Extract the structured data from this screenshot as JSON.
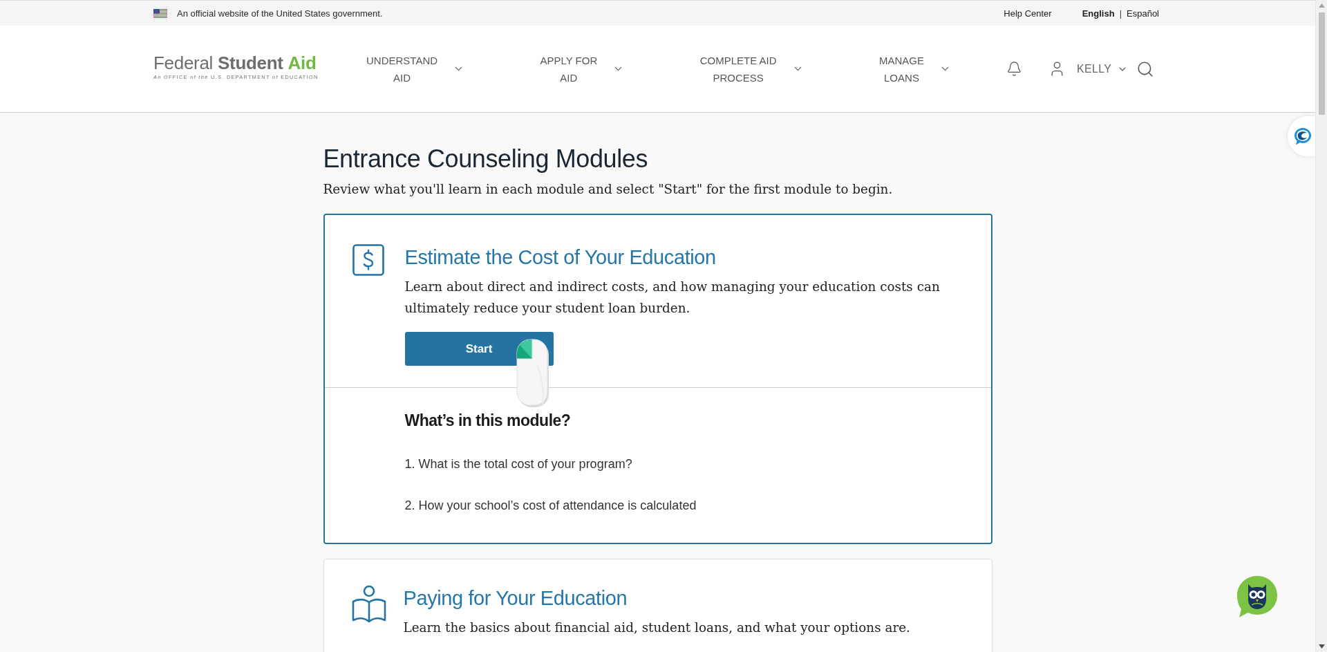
{
  "gov_banner": {
    "text": "An official website of the United States government.",
    "help_link": "Help Center",
    "languages": [
      {
        "label": "English",
        "selected": true
      },
      {
        "label": "Español",
        "selected": false
      }
    ],
    "language_separator": "|"
  },
  "header": {
    "logo": {
      "parts": [
        {
          "text": "Federal",
          "kind": "light"
        },
        {
          "text": "Student",
          "kind": "bold"
        },
        {
          "text": "Aid",
          "kind": "accent"
        }
      ],
      "tagline": "*An* OFFICE *of the* U.S. DEPARTMENT *of* EDUCATION"
    },
    "nav": [
      {
        "label": "UNDERSTAND AID"
      },
      {
        "label": "APPLY FOR AID"
      },
      {
        "label": "COMPLETE AID PROCESS"
      },
      {
        "label": "MANAGE LOANS"
      }
    ],
    "user": {
      "name": "KELLY"
    }
  },
  "page": {
    "title": "Entrance Counseling Modules",
    "intro": "Review what you'll learn in each module and select \"Start\" for the first module to begin."
  },
  "modules": [
    {
      "selected": true,
      "title": "Estimate the Cost of Your Education",
      "description": "Learn about direct and indirect costs, and how managing your education costs can ultimately reduce your student loan burden.",
      "button": "Start",
      "contents_heading": "What’s in this module?",
      "topics": [
        "1. What is the total cost of your program?",
        "2. How your school’s cost of attendance is calculated"
      ]
    },
    {
      "selected": false,
      "title": "Paying for Your Education",
      "description": "Learn the basics about financial aid, student loans, and what your options are."
    }
  ]
}
